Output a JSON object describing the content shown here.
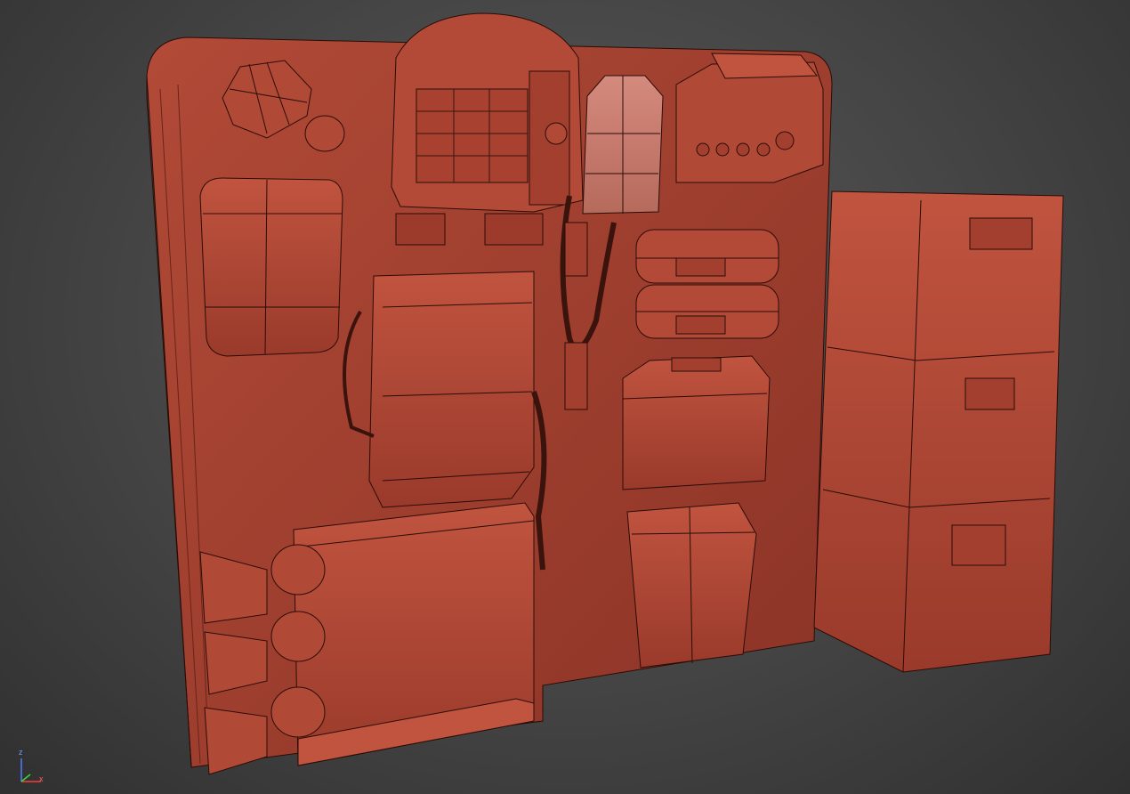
{
  "viewport": {
    "gizmo": {
      "z_label": "z",
      "x_label": "x",
      "z_color": "#4f7cff",
      "x_color": "#ff3b3b",
      "y_color": "#3bd63b"
    }
  },
  "colors": {
    "background": "#444444",
    "mesh_fill": "#a7412f",
    "mesh_shadow": "#7a2c20",
    "mesh_light": "#c0553f",
    "wire": "#2a0c07"
  }
}
